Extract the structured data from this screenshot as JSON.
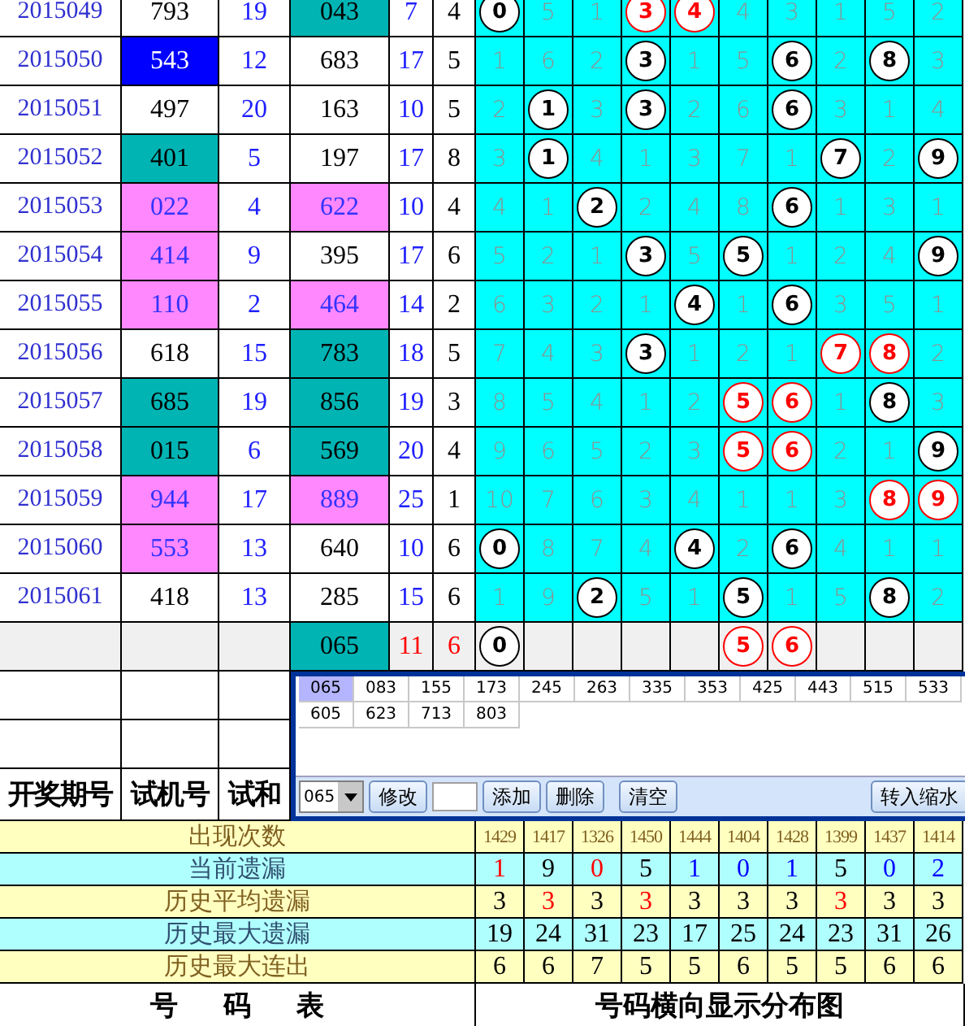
{
  "draws": [
    {
      "kind": "draw",
      "period": "2015049",
      "trial": {
        "text": "793",
        "color": "#ffffff"
      },
      "trial_sum": "19",
      "col4": {
        "text": "043",
        "color": "#00b4b4"
      },
      "col5": "7",
      "col6": "4",
      "digits": [
        {
          "text": "0",
          "kind": "ball"
        },
        {
          "text": "5",
          "kind": "miss"
        },
        {
          "text": "1",
          "kind": "miss"
        },
        {
          "text": "3",
          "kind": "redball"
        },
        {
          "text": "4",
          "kind": "redball"
        },
        {
          "text": "4",
          "kind": "miss"
        },
        {
          "text": "3",
          "kind": "miss"
        },
        {
          "text": "1",
          "kind": "miss"
        },
        {
          "text": "5",
          "kind": "miss"
        },
        {
          "text": "2",
          "kind": "miss"
        }
      ]
    },
    {
      "kind": "draw",
      "period": "2015050",
      "trial": {
        "text": "543",
        "color": "#0000ff"
      },
      "trial_sum": "12",
      "col4": {
        "text": "683",
        "color": "#ffffff"
      },
      "col5": "17",
      "col6": "5",
      "digits": [
        {
          "text": "1",
          "kind": "miss"
        },
        {
          "text": "6",
          "kind": "miss"
        },
        {
          "text": "2",
          "kind": "miss"
        },
        {
          "text": "3",
          "kind": "ball"
        },
        {
          "text": "1",
          "kind": "miss"
        },
        {
          "text": "5",
          "kind": "miss"
        },
        {
          "text": "6",
          "kind": "ball"
        },
        {
          "text": "2",
          "kind": "miss"
        },
        {
          "text": "8",
          "kind": "ball"
        },
        {
          "text": "3",
          "kind": "miss"
        }
      ]
    },
    {
      "kind": "draw",
      "period": "2015051",
      "trial": {
        "text": "497",
        "color": "#ffffff"
      },
      "trial_sum": "20",
      "col4": {
        "text": "163",
        "color": "#ffffff"
      },
      "col5": "10",
      "col6": "5",
      "digits": [
        {
          "text": "2",
          "kind": "miss"
        },
        {
          "text": "1",
          "kind": "ball"
        },
        {
          "text": "3",
          "kind": "miss"
        },
        {
          "text": "3",
          "kind": "ball"
        },
        {
          "text": "2",
          "kind": "miss"
        },
        {
          "text": "6",
          "kind": "miss"
        },
        {
          "text": "6",
          "kind": "ball"
        },
        {
          "text": "3",
          "kind": "miss"
        },
        {
          "text": "1",
          "kind": "miss"
        },
        {
          "text": "4",
          "kind": "miss"
        }
      ]
    },
    {
      "kind": "draw",
      "period": "2015052",
      "trial": {
        "text": "401",
        "color": "#00b4b4"
      },
      "trial_sum": "5",
      "col4": {
        "text": "197",
        "color": "#ffffff"
      },
      "col5": "17",
      "col6": "8",
      "digits": [
        {
          "text": "3",
          "kind": "miss"
        },
        {
          "text": "1",
          "kind": "ball"
        },
        {
          "text": "4",
          "kind": "miss"
        },
        {
          "text": "1",
          "kind": "miss"
        },
        {
          "text": "3",
          "kind": "miss"
        },
        {
          "text": "7",
          "kind": "miss"
        },
        {
          "text": "1",
          "kind": "miss"
        },
        {
          "text": "7",
          "kind": "ball"
        },
        {
          "text": "2",
          "kind": "miss"
        },
        {
          "text": "9",
          "kind": "ball"
        }
      ]
    },
    {
      "kind": "draw",
      "period": "2015053",
      "trial": {
        "text": "022",
        "color": "#ff88ff"
      },
      "trial_sum": "4",
      "col4": {
        "text": "622",
        "color": "#ff88ff"
      },
      "col5": "10",
      "col6": "4",
      "digits": [
        {
          "text": "4",
          "kind": "miss"
        },
        {
          "text": "1",
          "kind": "miss"
        },
        {
          "text": "2",
          "kind": "ball"
        },
        {
          "text": "2",
          "kind": "miss"
        },
        {
          "text": "4",
          "kind": "miss"
        },
        {
          "text": "8",
          "kind": "miss"
        },
        {
          "text": "6",
          "kind": "ball"
        },
        {
          "text": "1",
          "kind": "miss"
        },
        {
          "text": "3",
          "kind": "miss"
        },
        {
          "text": "1",
          "kind": "miss"
        }
      ]
    },
    {
      "kind": "draw",
      "period": "2015054",
      "trial": {
        "text": "414",
        "color": "#ff88ff"
      },
      "trial_sum": "9",
      "col4": {
        "text": "395",
        "color": "#ffffff"
      },
      "col5": "17",
      "col6": "6",
      "digits": [
        {
          "text": "5",
          "kind": "miss"
        },
        {
          "text": "2",
          "kind": "miss"
        },
        {
          "text": "1",
          "kind": "miss"
        },
        {
          "text": "3",
          "kind": "ball"
        },
        {
          "text": "5",
          "kind": "miss"
        },
        {
          "text": "5",
          "kind": "ball"
        },
        {
          "text": "1",
          "kind": "miss"
        },
        {
          "text": "2",
          "kind": "miss"
        },
        {
          "text": "4",
          "kind": "miss"
        },
        {
          "text": "9",
          "kind": "ball"
        }
      ]
    },
    {
      "kind": "draw",
      "period": "2015055",
      "trial": {
        "text": "110",
        "color": "#ff88ff"
      },
      "trial_sum": "2",
      "col4": {
        "text": "464",
        "color": "#ff88ff"
      },
      "col5": "14",
      "col6": "2",
      "digits": [
        {
          "text": "6",
          "kind": "miss"
        },
        {
          "text": "3",
          "kind": "miss"
        },
        {
          "text": "2",
          "kind": "miss"
        },
        {
          "text": "1",
          "kind": "miss"
        },
        {
          "text": "4",
          "kind": "ball"
        },
        {
          "text": "1",
          "kind": "miss"
        },
        {
          "text": "6",
          "kind": "ball"
        },
        {
          "text": "3",
          "kind": "miss"
        },
        {
          "text": "5",
          "kind": "miss"
        },
        {
          "text": "1",
          "kind": "miss"
        }
      ]
    },
    {
      "kind": "draw",
      "period": "2015056",
      "trial": {
        "text": "618",
        "color": "#ffffff"
      },
      "trial_sum": "15",
      "col4": {
        "text": "783",
        "color": "#00b4b4"
      },
      "col5": "18",
      "col6": "5",
      "digits": [
        {
          "text": "7",
          "kind": "miss"
        },
        {
          "text": "4",
          "kind": "miss"
        },
        {
          "text": "3",
          "kind": "miss"
        },
        {
          "text": "3",
          "kind": "ball"
        },
        {
          "text": "1",
          "kind": "miss"
        },
        {
          "text": "2",
          "kind": "miss"
        },
        {
          "text": "1",
          "kind": "miss"
        },
        {
          "text": "7",
          "kind": "redball"
        },
        {
          "text": "8",
          "kind": "redball"
        },
        {
          "text": "2",
          "kind": "miss"
        }
      ]
    },
    {
      "kind": "draw",
      "period": "2015057",
      "trial": {
        "text": "685",
        "color": "#00b4b4"
      },
      "trial_sum": "19",
      "col4": {
        "text": "856",
        "color": "#00b4b4"
      },
      "col5": "19",
      "col6": "3",
      "digits": [
        {
          "text": "8",
          "kind": "miss"
        },
        {
          "text": "5",
          "kind": "miss"
        },
        {
          "text": "4",
          "kind": "miss"
        },
        {
          "text": "1",
          "kind": "miss"
        },
        {
          "text": "2",
          "kind": "miss"
        },
        {
          "text": "5",
          "kind": "redball"
        },
        {
          "text": "6",
          "kind": "redball"
        },
        {
          "text": "1",
          "kind": "miss"
        },
        {
          "text": "8",
          "kind": "ball"
        },
        {
          "text": "3",
          "kind": "miss"
        }
      ]
    },
    {
      "kind": "draw",
      "period": "2015058",
      "trial": {
        "text": "015",
        "color": "#00b4b4"
      },
      "trial_sum": "6",
      "col4": {
        "text": "569",
        "color": "#00b4b4"
      },
      "col5": "20",
      "col6": "4",
      "digits": [
        {
          "text": "9",
          "kind": "miss"
        },
        {
          "text": "6",
          "kind": "miss"
        },
        {
          "text": "5",
          "kind": "miss"
        },
        {
          "text": "2",
          "kind": "miss"
        },
        {
          "text": "3",
          "kind": "miss"
        },
        {
          "text": "5",
          "kind": "redball"
        },
        {
          "text": "6",
          "kind": "redball"
        },
        {
          "text": "2",
          "kind": "miss"
        },
        {
          "text": "1",
          "kind": "miss"
        },
        {
          "text": "9",
          "kind": "ball"
        }
      ]
    },
    {
      "kind": "draw",
      "period": "2015059",
      "trial": {
        "text": "944",
        "color": "#ff88ff"
      },
      "trial_sum": "17",
      "col4": {
        "text": "889",
        "color": "#ff88ff"
      },
      "col5": "25",
      "col6": "1",
      "digits": [
        {
          "text": "10",
          "kind": "miss"
        },
        {
          "text": "7",
          "kind": "miss"
        },
        {
          "text": "6",
          "kind": "miss"
        },
        {
          "text": "3",
          "kind": "miss"
        },
        {
          "text": "4",
          "kind": "miss"
        },
        {
          "text": "1",
          "kind": "miss"
        },
        {
          "text": "1",
          "kind": "miss"
        },
        {
          "text": "3",
          "kind": "miss"
        },
        {
          "text": "8",
          "kind": "redball"
        },
        {
          "text": "9",
          "kind": "redball"
        }
      ]
    },
    {
      "kind": "draw",
      "period": "2015060",
      "trial": {
        "text": "553",
        "color": "#ff88ff"
      },
      "trial_sum": "13",
      "col4": {
        "text": "640",
        "color": "#ffffff"
      },
      "col5": "10",
      "col6": "6",
      "digits": [
        {
          "text": "0",
          "kind": "ball"
        },
        {
          "text": "8",
          "kind": "miss"
        },
        {
          "text": "7",
          "kind": "miss"
        },
        {
          "text": "4",
          "kind": "miss"
        },
        {
          "text": "4",
          "kind": "ball"
        },
        {
          "text": "2",
          "kind": "miss"
        },
        {
          "text": "6",
          "kind": "ball"
        },
        {
          "text": "4",
          "kind": "miss"
        },
        {
          "text": "1",
          "kind": "miss"
        },
        {
          "text": "1",
          "kind": "miss"
        }
      ]
    },
    {
      "kind": "draw",
      "period": "2015061",
      "trial": {
        "text": "418",
        "color": "#ffffff"
      },
      "trial_sum": "13",
      "col4": {
        "text": "285",
        "color": "#ffffff"
      },
      "col5": "15",
      "col6": "6",
      "digits": [
        {
          "text": "1",
          "kind": "miss"
        },
        {
          "text": "9",
          "kind": "miss"
        },
        {
          "text": "2",
          "kind": "ball"
        },
        {
          "text": "5",
          "kind": "miss"
        },
        {
          "text": "1",
          "kind": "miss"
        },
        {
          "text": "5",
          "kind": "ball"
        },
        {
          "text": "1",
          "kind": "miss"
        },
        {
          "text": "5",
          "kind": "miss"
        },
        {
          "text": "8",
          "kind": "ball"
        },
        {
          "text": "2",
          "kind": "miss"
        }
      ]
    },
    {
      "kind": "forecast",
      "col4": {
        "text": "065",
        "color": "#00b4b4"
      },
      "col5": "11",
      "col6": "6",
      "digits": [
        {
          "text": "0",
          "kind": "ball"
        },
        {
          "kind": "blank"
        },
        {
          "kind": "blank"
        },
        {
          "kind": "blank"
        },
        {
          "kind": "blank"
        },
        {
          "text": "5",
          "kind": "redball"
        },
        {
          "text": "6",
          "kind": "redball"
        },
        {
          "kind": "blank"
        },
        {
          "kind": "blank"
        },
        {
          "kind": "blank"
        }
      ]
    }
  ],
  "header": [
    "开奖期号",
    "试机号",
    "试和"
  ],
  "dialog": {
    "numbers": [
      {
        "text": "065",
        "selected": true
      },
      {
        "text": "083",
        "selected": false
      },
      {
        "text": "155",
        "selected": false
      },
      {
        "text": "173",
        "selected": false
      },
      {
        "text": "245",
        "selected": false
      },
      {
        "text": "263",
        "selected": false
      },
      {
        "text": "335",
        "selected": false
      },
      {
        "text": "353",
        "selected": false
      },
      {
        "text": "425",
        "selected": false
      },
      {
        "text": "443",
        "selected": false
      },
      {
        "text": "515",
        "selected": false
      },
      {
        "text": "533",
        "selected": false
      },
      {
        "text": "605",
        "selected": false
      },
      {
        "text": "623",
        "selected": false
      },
      {
        "text": "713",
        "selected": false
      },
      {
        "text": "803",
        "selected": false
      }
    ],
    "select": "065",
    "modify": "修改",
    "add": "添加",
    "delete": "删除",
    "clear": "清空",
    "transfer": "转入缩水"
  },
  "stats": [
    {
      "label": "出现次数",
      "values": [
        {
          "text": "1429",
          "color": "#806020"
        },
        {
          "text": "1417",
          "color": "#806020"
        },
        {
          "text": "1326",
          "color": "#806020"
        },
        {
          "text": "1450",
          "color": "#806020"
        },
        {
          "text": "1444",
          "color": "#806020"
        },
        {
          "text": "1404",
          "color": "#806020"
        },
        {
          "text": "1428",
          "color": "#806020"
        },
        {
          "text": "1399",
          "color": "#806020"
        },
        {
          "text": "1437",
          "color": "#806020"
        },
        {
          "text": "1414",
          "color": "#806020"
        }
      ]
    },
    {
      "label": "当前遗漏",
      "values": [
        {
          "text": "1",
          "color": "#ff0000"
        },
        {
          "text": "9",
          "color": "#000000"
        },
        {
          "text": "0",
          "color": "#ff0000"
        },
        {
          "text": "5",
          "color": "#000000"
        },
        {
          "text": "1",
          "color": "#0000ff"
        },
        {
          "text": "0",
          "color": "#0000ff"
        },
        {
          "text": "1",
          "color": "#0000ff"
        },
        {
          "text": "5",
          "color": "#000000"
        },
        {
          "text": "0",
          "color": "#0000ff"
        },
        {
          "text": "2",
          "color": "#0000ff"
        }
      ]
    },
    {
      "label": "历史平均遗漏",
      "values": [
        {
          "text": "3",
          "color": "#000000"
        },
        {
          "text": "3",
          "color": "#ff0000"
        },
        {
          "text": "3",
          "color": "#000000"
        },
        {
          "text": "3",
          "color": "#ff0000"
        },
        {
          "text": "3",
          "color": "#000000"
        },
        {
          "text": "3",
          "color": "#000000"
        },
        {
          "text": "3",
          "color": "#000000"
        },
        {
          "text": "3",
          "color": "#ff0000"
        },
        {
          "text": "3",
          "color": "#000000"
        },
        {
          "text": "3",
          "color": "#000000"
        }
      ]
    },
    {
      "label": "历史最大遗漏",
      "values": [
        {
          "text": "19",
          "color": "#000000"
        },
        {
          "text": "24",
          "color": "#000000"
        },
        {
          "text": "31",
          "color": "#000000"
        },
        {
          "text": "23",
          "color": "#000000"
        },
        {
          "text": "17",
          "color": "#000000"
        },
        {
          "text": "25",
          "color": "#000000"
        },
        {
          "text": "24",
          "color": "#000000"
        },
        {
          "text": "23",
          "color": "#000000"
        },
        {
          "text": "31",
          "color": "#000000"
        },
        {
          "text": "26",
          "color": "#000000"
        }
      ]
    },
    {
      "label": "历史最大连出",
      "values": [
        {
          "text": "6",
          "color": "#000000"
        },
        {
          "text": "6",
          "color": "#000000"
        },
        {
          "text": "7",
          "color": "#000000"
        },
        {
          "text": "5",
          "color": "#000000"
        },
        {
          "text": "5",
          "color": "#000000"
        },
        {
          "text": "6",
          "color": "#000000"
        },
        {
          "text": "5",
          "color": "#000000"
        },
        {
          "text": "5",
          "color": "#000000"
        },
        {
          "text": "6",
          "color": "#000000"
        },
        {
          "text": "6",
          "color": "#000000"
        }
      ]
    }
  ],
  "footer": {
    "left": "号 码 表",
    "right": "号码横向显示分布图"
  }
}
